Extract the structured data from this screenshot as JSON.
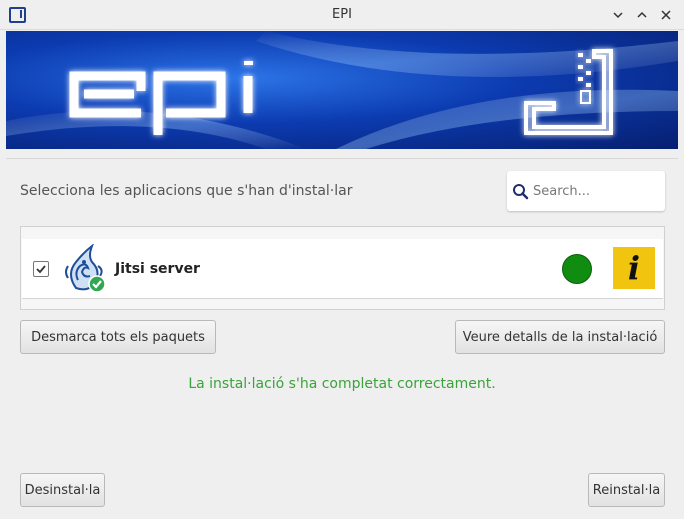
{
  "window": {
    "title": "EPI",
    "controls": [
      "minimize-icon",
      "maximize-icon",
      "close-icon"
    ]
  },
  "banner": {
    "logo_text": "epi"
  },
  "header": {
    "prompt": "Selecciona les aplicacions que s'han d'instal·lar",
    "search_placeholder": "Search..."
  },
  "packages": [
    {
      "name": "Jitsi server",
      "checked": true,
      "icon": "jitsi-icon",
      "installed_badge": "check-badge-icon",
      "status_color": "#108d10",
      "info_label": "i"
    }
  ],
  "actions": {
    "unmark_all": "Desmarca tots els paquets",
    "view_details": "Veure detalls de la instal·lació",
    "uninstall": "Desinstal·la",
    "reinstall": "Reinstal·la"
  },
  "status_message": "La instal·lació s'ha completat correctament.",
  "colors": {
    "success_text": "#3aa33a",
    "info_button": "#f1c40f",
    "banner_blue": "#0c3bb0"
  }
}
